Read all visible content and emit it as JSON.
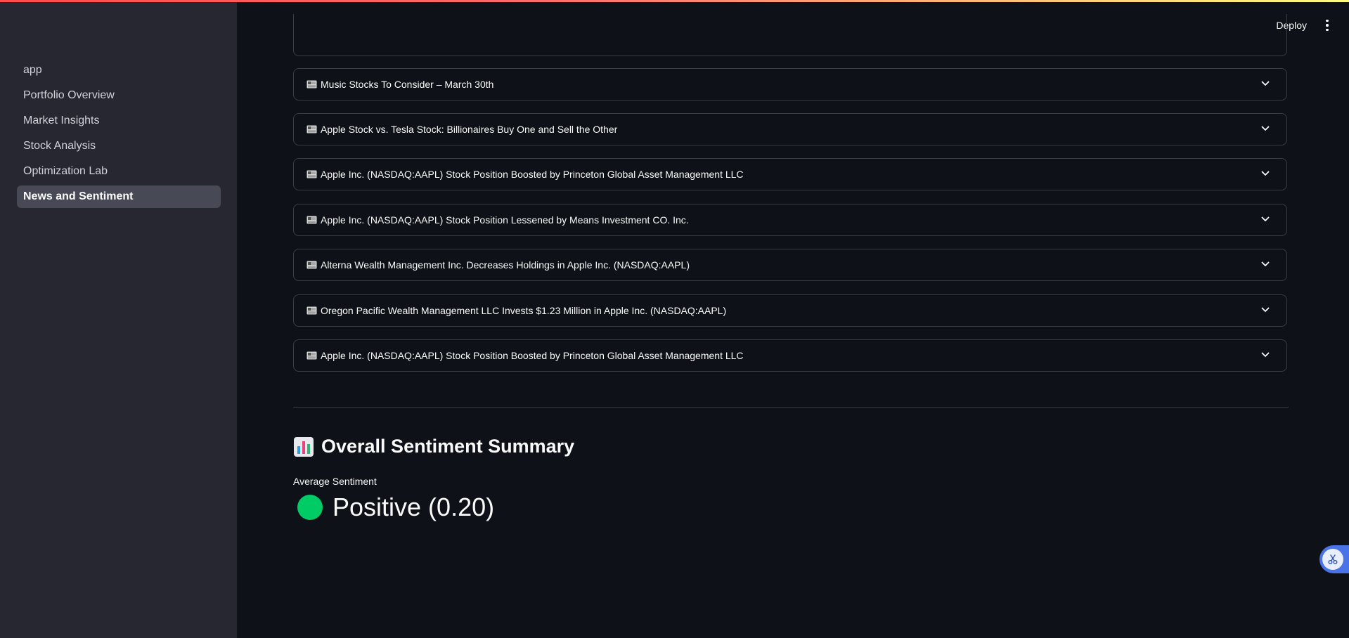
{
  "sidebar": {
    "items": [
      {
        "label": "app",
        "active": false
      },
      {
        "label": "Portfolio Overview",
        "active": false
      },
      {
        "label": "Market Insights",
        "active": false
      },
      {
        "label": "Stock Analysis",
        "active": false
      },
      {
        "label": "Optimization Lab",
        "active": false
      },
      {
        "label": "News and Sentiment",
        "active": true
      }
    ]
  },
  "header": {
    "deploy_label": "Deploy",
    "menu_icon": "kebab-menu-icon"
  },
  "news": {
    "item_icon": "newspaper-icon",
    "items": [
      {
        "title": "Music Stocks To Consider – March 30th"
      },
      {
        "title": "Apple Stock vs. Tesla Stock: Billionaires Buy One and Sell the Other"
      },
      {
        "title": "Apple Inc. (NASDAQ:AAPL) Stock Position Boosted by Princeton Global Asset Management LLC"
      },
      {
        "title": "Apple Inc. (NASDAQ:AAPL) Stock Position Lessened by Means Investment CO. Inc."
      },
      {
        "title": "Alterna Wealth Management Inc. Decreases Holdings in Apple Inc. (NASDAQ:AAPL)"
      },
      {
        "title": "Oregon Pacific Wealth Management LLC Invests $1.23 Million in Apple Inc. (NASDAQ:AAPL)"
      },
      {
        "title": "Apple Inc. (NASDAQ:AAPL) Stock Position Boosted by Princeton Global Asset Management LLC"
      }
    ]
  },
  "summary": {
    "heading_icon": "bar-chart-icon",
    "heading": "Overall Sentiment Summary",
    "metric_label": "Average Sentiment",
    "metric_value": "Positive (0.20)",
    "status_color": "#00cc66"
  },
  "colors": {
    "background": "#0e1117",
    "sidebar": "#262730",
    "border": "#3a3d47",
    "active_nav": "#474955",
    "accent_red": "#ff4b4b",
    "accent_blue": "#4a73e8"
  },
  "floating_button_icon": "scissors-icon"
}
